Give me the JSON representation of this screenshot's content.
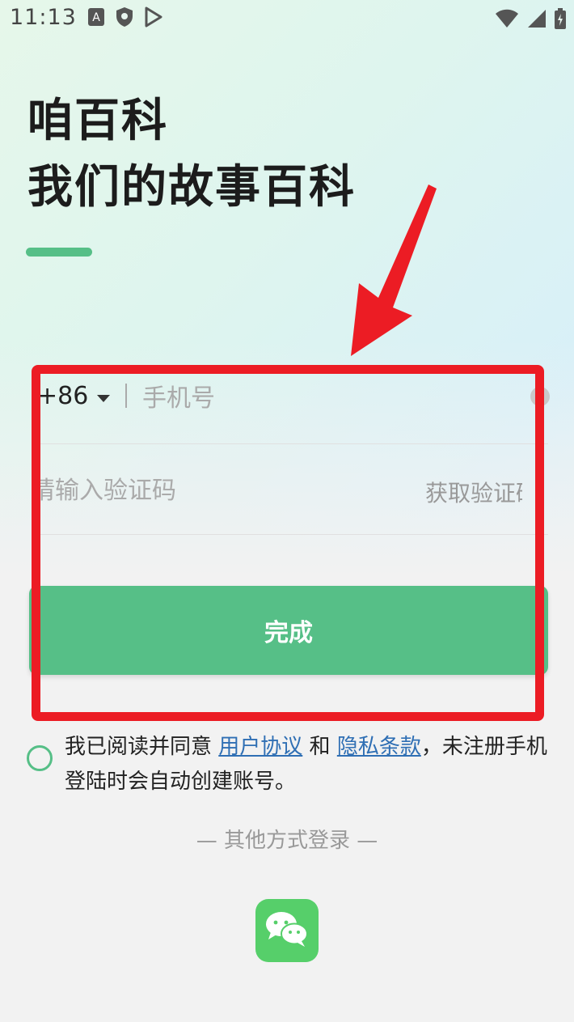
{
  "status_bar": {
    "time": "11:13"
  },
  "header": {
    "title_line1": "咱百科",
    "title_line2": "我们的故事百科"
  },
  "login_form": {
    "country_code": "+86",
    "phone_placeholder": "手机号",
    "code_placeholder": "请输入验证码",
    "get_code_label": "获取验证码",
    "submit_label": "完成"
  },
  "agreement": {
    "text_before": "我已阅读并同意 ",
    "user_agreement_link": "用户协议",
    "text_and": " 和 ",
    "privacy_link": "隐私条款",
    "text_after": "，未注册手机登陆时会自动创建账号。"
  },
  "other_login": {
    "label": "— 其他方式登录 —"
  },
  "colors": {
    "accent": "#56bf87",
    "wechat": "#56cf6a",
    "highlight": "#ec1c24",
    "link": "#2f6fb4"
  },
  "icons": [
    "app-icon",
    "a-badge-icon",
    "shield-icon",
    "play-store-icon",
    "wifi-icon",
    "signal-icon",
    "battery-icon",
    "close-icon",
    "dropdown-arrow-icon",
    "wechat-icon",
    "pointer-arrow-icon"
  ]
}
